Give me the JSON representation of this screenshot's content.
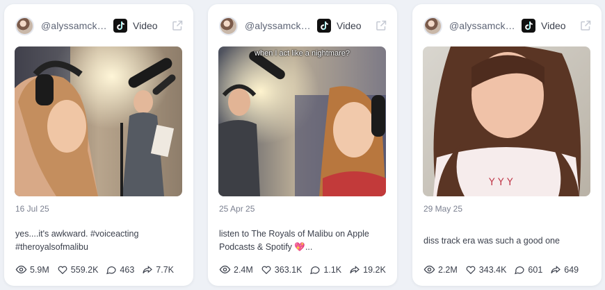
{
  "posts": [
    {
      "handle": "@alyssamckay...",
      "platform": "Video",
      "overlay_text": "",
      "date": "16 Jul 25",
      "caption": "yes....it's awkward. #voiceacting #theroyalsofmalibu",
      "views": "5.9M",
      "likes": "559.2K",
      "comments": "463",
      "shares": "7.7K"
    },
    {
      "handle": "@alyssamckay...",
      "platform": "Video",
      "overlay_text": "when I act like a nightmare?",
      "date": "25 Apr 25",
      "caption": "listen to The Royals of Malibu on Apple Podcasts & Spotify 💖...",
      "views": "2.4M",
      "likes": "363.1K",
      "comments": "1.1K",
      "shares": "19.2K"
    },
    {
      "handle": "@alyssamckay...",
      "platform": "Video",
      "overlay_text": "",
      "date": "29 May 25",
      "caption": "diss track era was such a good one",
      "views": "2.2M",
      "likes": "343.4K",
      "comments": "601",
      "shares": "649"
    }
  ],
  "colors": {
    "background": "#eef1f6",
    "card": "#ffffff",
    "muted_text": "#7b8090",
    "body_text": "#3a3f4b"
  },
  "icons": {
    "views": "eye-icon",
    "likes": "heart-icon",
    "comments": "comment-icon",
    "shares": "share-icon",
    "external": "external-link-icon",
    "platform": "tiktok-icon"
  }
}
